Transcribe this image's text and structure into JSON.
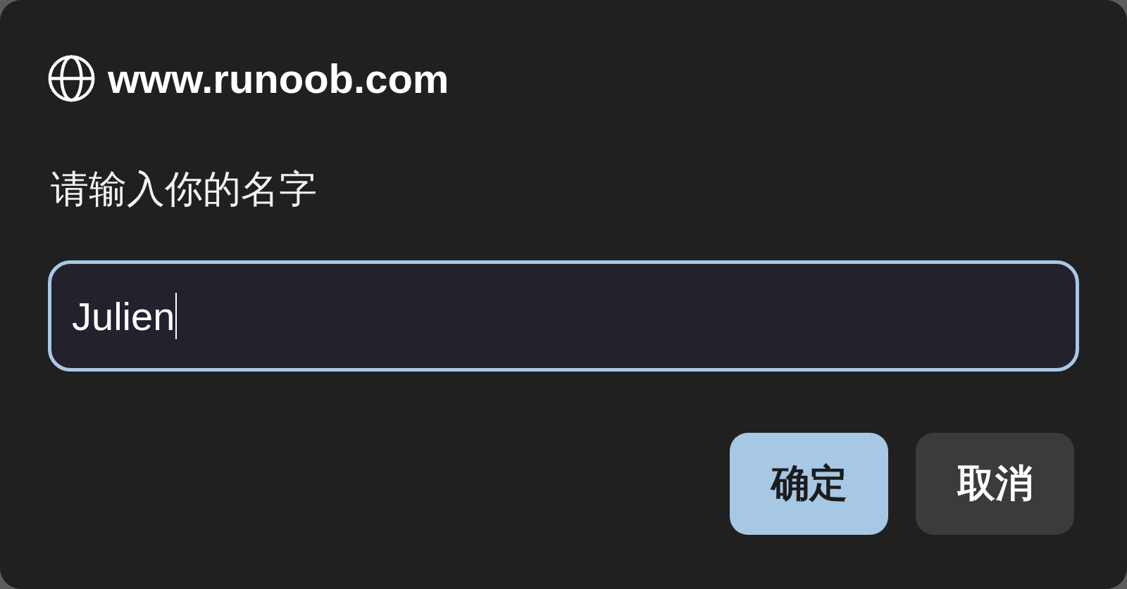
{
  "dialog": {
    "site": "www.runoob.com",
    "message": "请输入你的名字",
    "input": {
      "value": "Julien",
      "focused": true
    },
    "buttons": [
      {
        "label": "确定",
        "kind": "primary"
      },
      {
        "label": "取消",
        "kind": "secondary"
      }
    ]
  }
}
